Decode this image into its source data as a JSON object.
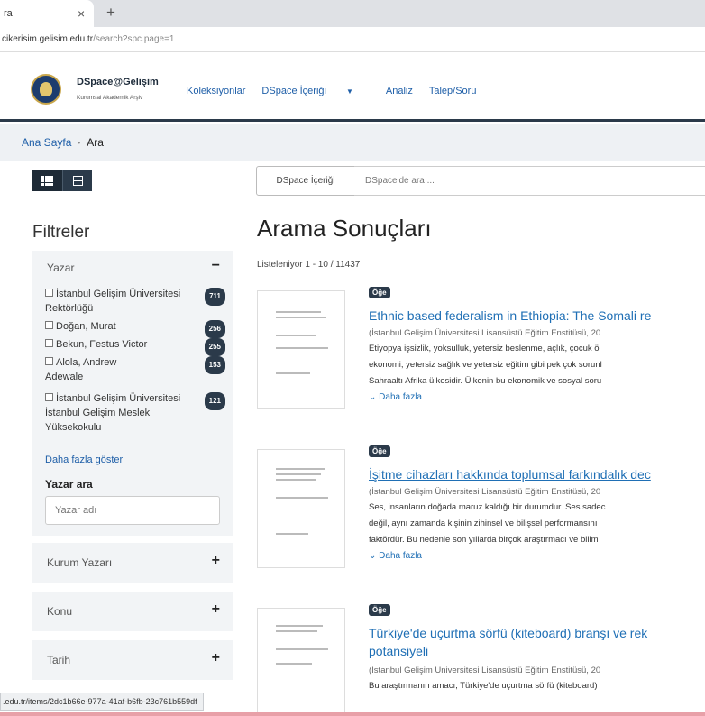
{
  "browser": {
    "tab_title": "ra",
    "url_host": "cikerisim.gelisim.edu.tr",
    "url_path": "/search?spc.page=1",
    "status_link": ".edu.tr/items/2dc1b66e-977a-41af-b6fb-23c761b559df"
  },
  "header": {
    "brand_title": "DSpace@Gelişim",
    "brand_subtitle": "Kurumsal Akademik Arşiv",
    "nav": [
      "Koleksiyonlar",
      "DSpace İçeriği",
      "Analiz",
      "Talep/Soru"
    ]
  },
  "breadcrumb": {
    "home": "Ana Sayfa",
    "current": "Ara"
  },
  "search": {
    "scope": "DSpace İçeriği",
    "placeholder": "DSpace'de ara ..."
  },
  "sidebar": {
    "title": "Filtreler",
    "yazar": {
      "label": "Yazar",
      "toggle": "−",
      "facets": [
        {
          "name": "İstanbul Gelişim Üniversitesi Rektörlüğü",
          "count": "711"
        },
        {
          "name": "Doğan, Murat",
          "count": "256"
        },
        {
          "name": "Bekun, Festus Victor",
          "count": "255"
        },
        {
          "name": "Alola, Andrew Adewale",
          "count": "153"
        },
        {
          "name": "İstanbul Gelişim Üniversitesi İstanbul Gelişim Meslek Yüksekokulu",
          "count": "121"
        }
      ],
      "show_more": "Daha fazla göster",
      "search_label": "Yazar ara",
      "search_placeholder": "Yazar adı"
    },
    "others": [
      {
        "label": "Kurum Yazarı",
        "toggle": "+"
      },
      {
        "label": "Konu",
        "toggle": "+"
      },
      {
        "label": "Tarih",
        "toggle": "+"
      }
    ]
  },
  "results": {
    "title": "Arama Sonuçları",
    "count": "Listeleniyor 1 - 10 / 11437",
    "items": [
      {
        "type": "Öğe",
        "title": "Ethnic based federalism in Ethiopia: The Somali re",
        "meta": "(İstanbul Gelişim Üniversitesi Lisansüstü Eğitim Enstitüsü, 20",
        "abstract": [
          "Etiyopya işsizlik, yoksulluk, yetersiz beslenme, açlık, çocuk öl",
          "ekonomi, yetersiz sağlık ve yetersiz eğitim gibi pek çok sorunl",
          "Sahraaltı Afrika ülkesidir. Ülkenin bu ekonomik ve sosyal soru"
        ],
        "more": "Daha fazla"
      },
      {
        "type": "Öğe",
        "title": "İşitme cihazları hakkında toplumsal farkındalık dec",
        "meta": "(İstanbul Gelişim Üniversitesi Lisansüstü Eğitim Enstitüsü, 20",
        "abstract": [
          "Ses, insanların doğada maruz kaldığı bir durumdur. Ses sadec",
          "değil, aynı zamanda kişinin zihinsel ve bilişsel performansını",
          "faktördür. Bu nedenle son yıllarda birçok araştırmacı ve bilim"
        ],
        "more": "Daha fazla"
      },
      {
        "type": "Öğe",
        "title": "Türkiye'de uçurtma sörfü (kiteboard) branşı ve rek potansiyeli",
        "meta": "(İstanbul Gelişim Üniversitesi Lisansüstü Eğitim Enstitüsü, 20",
        "abstract": [
          "Bu araştırmanın amacı, Türkiye'de uçurtma sörfü (kiteboard)"
        ]
      }
    ]
  }
}
